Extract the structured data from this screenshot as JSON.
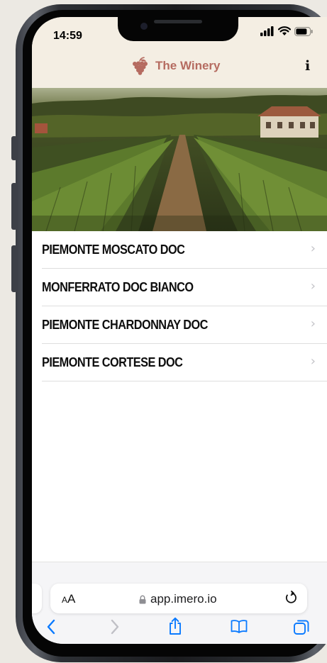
{
  "status_bar": {
    "time": "14:59"
  },
  "header": {
    "title": "The Winery",
    "info_label": "i"
  },
  "hero": {
    "alt": "Vineyard rows leading to a farmhouse"
  },
  "menu": {
    "items": [
      {
        "label": "PIEMONTE MOSCATO DOC"
      },
      {
        "label": "MONFERRATO DOC BIANCO"
      },
      {
        "label": "PIEMONTE CHARDONNAY DOC"
      },
      {
        "label": "PIEMONTE CORTESE DOC"
      }
    ]
  },
  "browser": {
    "aa_small": "A",
    "aa_large": "A",
    "url": "app.imero.io",
    "toolbar_icons": [
      "back-icon",
      "forward-icon",
      "share-icon",
      "bookmarks-icon",
      "tabs-icon"
    ]
  },
  "colors": {
    "header_bg": "#f4eee3",
    "brand": "#b56b60",
    "ios_blue": "#0a7aff",
    "chevron": "#c3c3c8"
  }
}
